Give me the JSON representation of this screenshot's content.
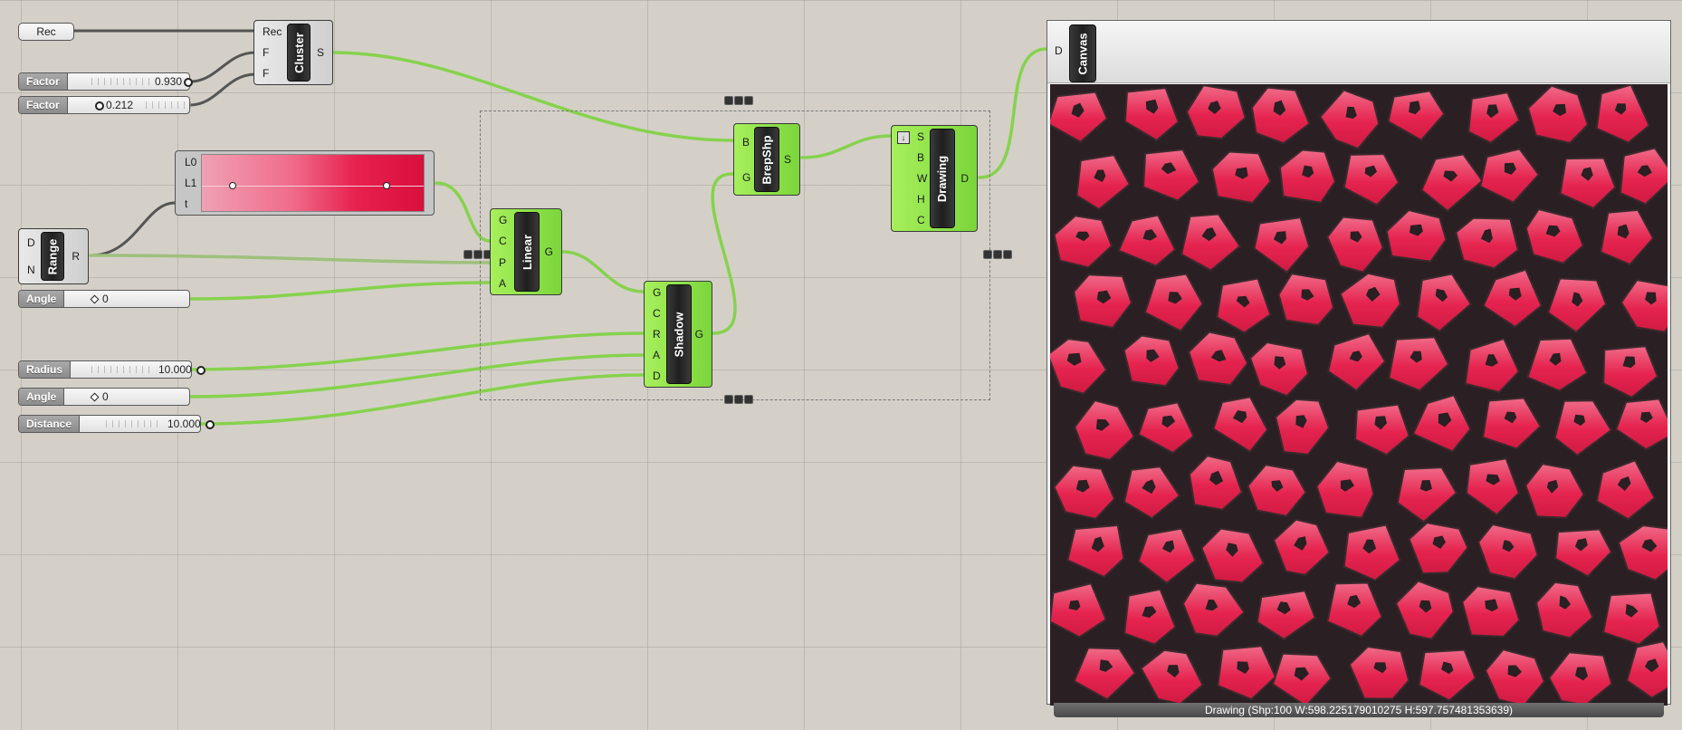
{
  "rec_panel": {
    "label": "Rec"
  },
  "sliders": {
    "factor1": {
      "label": "Factor",
      "value": "0.930"
    },
    "factor2": {
      "label": "Factor",
      "value": "0.212"
    },
    "angle1": {
      "label": "Angle",
      "value": "0"
    },
    "radius": {
      "label": "Radius",
      "value": "10.000"
    },
    "angle2": {
      "label": "Angle",
      "value": "0"
    },
    "distance": {
      "label": "Distance",
      "value": "10.000"
    }
  },
  "gradient": {
    "inputs": [
      "L0",
      "L1",
      "t"
    ]
  },
  "components": {
    "cluster": {
      "name": "Cluster",
      "inputs": [
        "Rec",
        "F",
        "F"
      ],
      "outputs": [
        "S"
      ]
    },
    "range": {
      "name": "Range",
      "inputs": [
        "D",
        "N"
      ],
      "outputs": [
        "R"
      ]
    },
    "linear": {
      "name": "Linear",
      "inputs": [
        "G",
        "C",
        "P",
        "A"
      ],
      "outputs": [
        "G"
      ]
    },
    "shadow": {
      "name": "Shadow",
      "inputs": [
        "G",
        "C",
        "R",
        "A",
        "D"
      ],
      "outputs": [
        "G"
      ]
    },
    "brepshp": {
      "name": "BrepShp",
      "inputs": [
        "B",
        "G"
      ],
      "outputs": [
        "S"
      ]
    },
    "drawing": {
      "name": "Drawing",
      "inputs": [
        "S",
        "B",
        "W",
        "H",
        "C"
      ],
      "outputs": [
        "D"
      ]
    },
    "canvas": {
      "name": "Canvas",
      "inputs": [
        "D"
      ]
    }
  },
  "status": {
    "text": "Drawing (Shp:100 W:598.225179010275 H:597.757481353639)"
  },
  "colors": {
    "wire": "#7ed14a",
    "cell": "#e5244f",
    "gap": "#2a1f22"
  }
}
